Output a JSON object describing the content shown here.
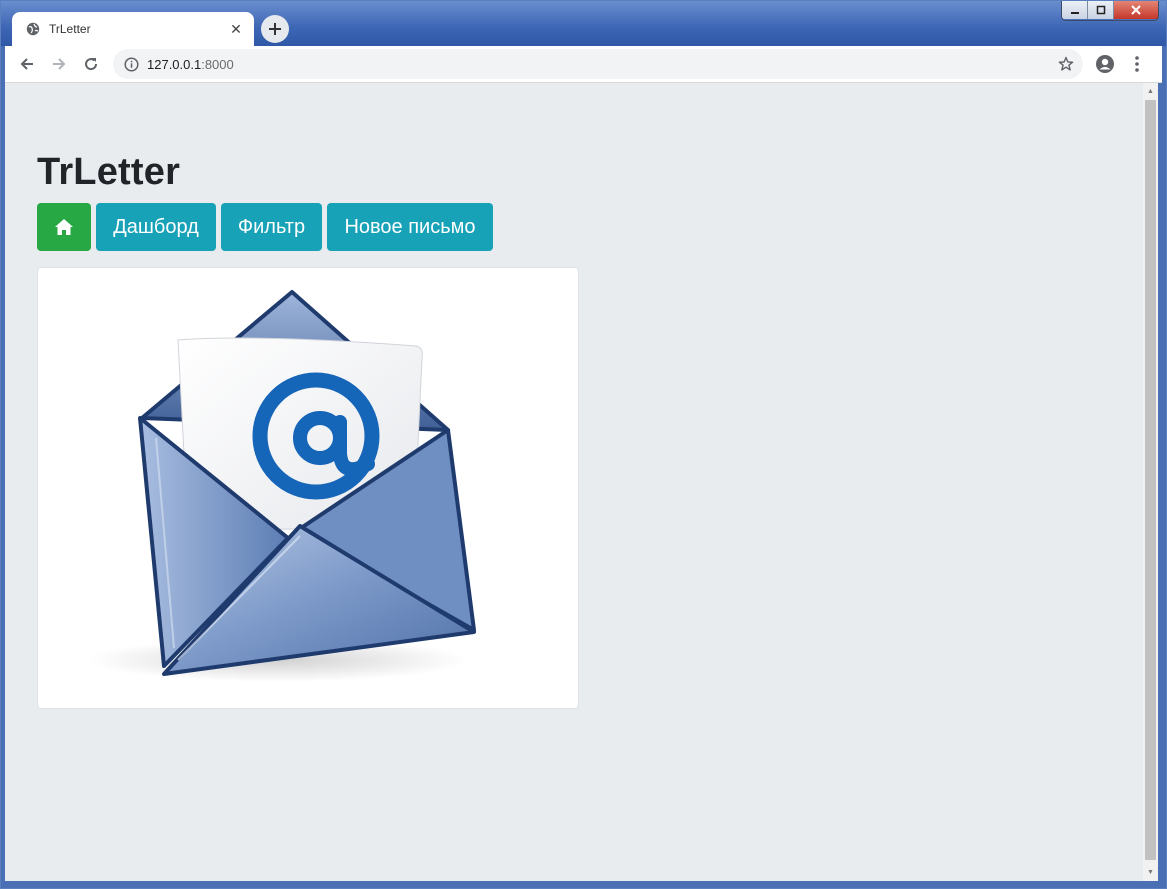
{
  "browser": {
    "tab_title": "TrLetter",
    "url_host": "127.0.0.1",
    "url_port": ":8000"
  },
  "page": {
    "title": "TrLetter",
    "nav": {
      "home_icon": "home-icon",
      "dashboard_label": "Дашборд",
      "filter_label": "Фильтр",
      "new_letter_label": "Новое письмо"
    },
    "image": {
      "subject": "open-envelope-with-at-sign-letter"
    }
  },
  "colors": {
    "success": "#28a745",
    "info": "#17a2b8",
    "page_bg": "#e9ecef",
    "envelope_blue": "#5a7fb8",
    "at_sign_blue": "#1565b8"
  }
}
